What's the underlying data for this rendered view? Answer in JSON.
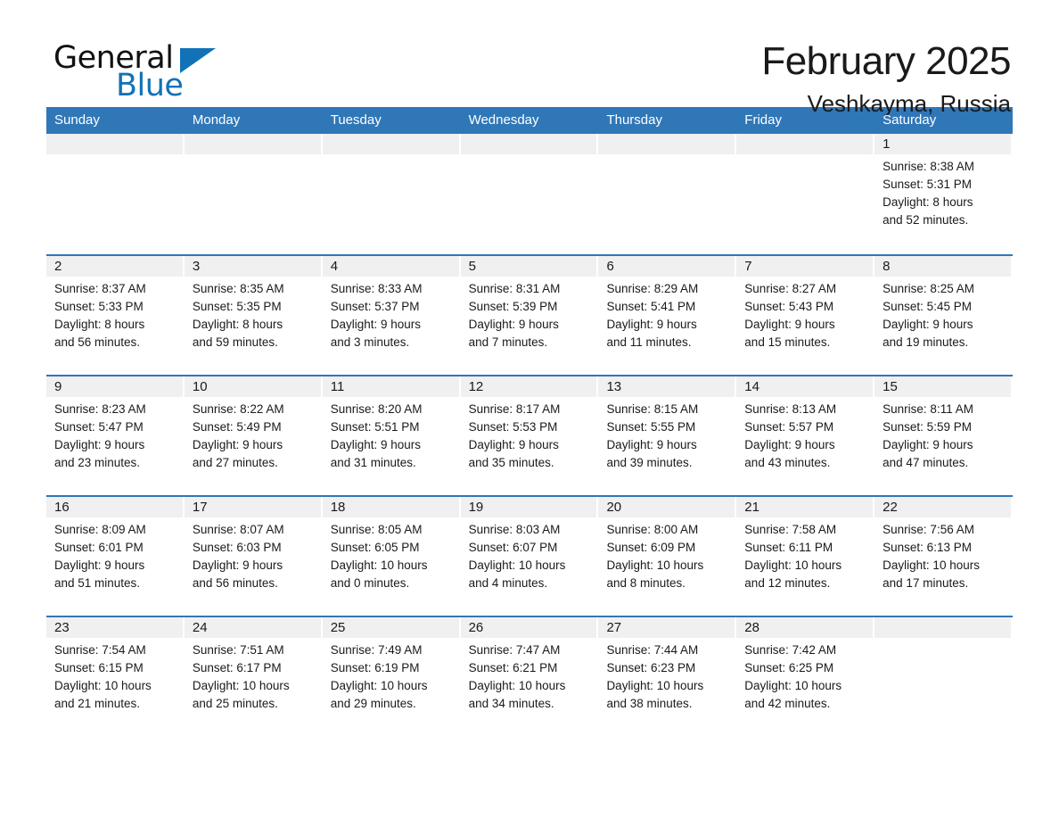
{
  "logo": {
    "text_primary": "General",
    "text_secondary": "Blue",
    "triangle_color": "#1272B8"
  },
  "header": {
    "title": "February 2025",
    "subtitle": "Veshkayma, Russia"
  },
  "theme": {
    "header_blue": "#3077B8",
    "row_rule_blue": "#3077B8",
    "day_band_gray": "#f0f0f0",
    "text_color": "#1a1a1a"
  },
  "weekdays": [
    "Sunday",
    "Monday",
    "Tuesday",
    "Wednesday",
    "Thursday",
    "Friday",
    "Saturday"
  ],
  "labels": {
    "sunrise_prefix": "Sunrise:",
    "sunset_prefix": "Sunset:",
    "daylight_prefix": "Daylight:"
  },
  "weeks": [
    [
      {
        "day": "",
        "line1": "",
        "line2": "",
        "line3": "",
        "line4": ""
      },
      {
        "day": "",
        "line1": "",
        "line2": "",
        "line3": "",
        "line4": ""
      },
      {
        "day": "",
        "line1": "",
        "line2": "",
        "line3": "",
        "line4": ""
      },
      {
        "day": "",
        "line1": "",
        "line2": "",
        "line3": "",
        "line4": ""
      },
      {
        "day": "",
        "line1": "",
        "line2": "",
        "line3": "",
        "line4": ""
      },
      {
        "day": "",
        "line1": "",
        "line2": "",
        "line3": "",
        "line4": ""
      },
      {
        "day": "1",
        "line1": "Sunrise: 8:38 AM",
        "line2": "Sunset: 5:31 PM",
        "line3": "Daylight: 8 hours",
        "line4": "and 52 minutes."
      }
    ],
    [
      {
        "day": "2",
        "line1": "Sunrise: 8:37 AM",
        "line2": "Sunset: 5:33 PM",
        "line3": "Daylight: 8 hours",
        "line4": "and 56 minutes."
      },
      {
        "day": "3",
        "line1": "Sunrise: 8:35 AM",
        "line2": "Sunset: 5:35 PM",
        "line3": "Daylight: 8 hours",
        "line4": "and 59 minutes."
      },
      {
        "day": "4",
        "line1": "Sunrise: 8:33 AM",
        "line2": "Sunset: 5:37 PM",
        "line3": "Daylight: 9 hours",
        "line4": "and 3 minutes."
      },
      {
        "day": "5",
        "line1": "Sunrise: 8:31 AM",
        "line2": "Sunset: 5:39 PM",
        "line3": "Daylight: 9 hours",
        "line4": "and 7 minutes."
      },
      {
        "day": "6",
        "line1": "Sunrise: 8:29 AM",
        "line2": "Sunset: 5:41 PM",
        "line3": "Daylight: 9 hours",
        "line4": "and 11 minutes."
      },
      {
        "day": "7",
        "line1": "Sunrise: 8:27 AM",
        "line2": "Sunset: 5:43 PM",
        "line3": "Daylight: 9 hours",
        "line4": "and 15 minutes."
      },
      {
        "day": "8",
        "line1": "Sunrise: 8:25 AM",
        "line2": "Sunset: 5:45 PM",
        "line3": "Daylight: 9 hours",
        "line4": "and 19 minutes."
      }
    ],
    [
      {
        "day": "9",
        "line1": "Sunrise: 8:23 AM",
        "line2": "Sunset: 5:47 PM",
        "line3": "Daylight: 9 hours",
        "line4": "and 23 minutes."
      },
      {
        "day": "10",
        "line1": "Sunrise: 8:22 AM",
        "line2": "Sunset: 5:49 PM",
        "line3": "Daylight: 9 hours",
        "line4": "and 27 minutes."
      },
      {
        "day": "11",
        "line1": "Sunrise: 8:20 AM",
        "line2": "Sunset: 5:51 PM",
        "line3": "Daylight: 9 hours",
        "line4": "and 31 minutes."
      },
      {
        "day": "12",
        "line1": "Sunrise: 8:17 AM",
        "line2": "Sunset: 5:53 PM",
        "line3": "Daylight: 9 hours",
        "line4": "and 35 minutes."
      },
      {
        "day": "13",
        "line1": "Sunrise: 8:15 AM",
        "line2": "Sunset: 5:55 PM",
        "line3": "Daylight: 9 hours",
        "line4": "and 39 minutes."
      },
      {
        "day": "14",
        "line1": "Sunrise: 8:13 AM",
        "line2": "Sunset: 5:57 PM",
        "line3": "Daylight: 9 hours",
        "line4": "and 43 minutes."
      },
      {
        "day": "15",
        "line1": "Sunrise: 8:11 AM",
        "line2": "Sunset: 5:59 PM",
        "line3": "Daylight: 9 hours",
        "line4": "and 47 minutes."
      }
    ],
    [
      {
        "day": "16",
        "line1": "Sunrise: 8:09 AM",
        "line2": "Sunset: 6:01 PM",
        "line3": "Daylight: 9 hours",
        "line4": "and 51 minutes."
      },
      {
        "day": "17",
        "line1": "Sunrise: 8:07 AM",
        "line2": "Sunset: 6:03 PM",
        "line3": "Daylight: 9 hours",
        "line4": "and 56 minutes."
      },
      {
        "day": "18",
        "line1": "Sunrise: 8:05 AM",
        "line2": "Sunset: 6:05 PM",
        "line3": "Daylight: 10 hours",
        "line4": "and 0 minutes."
      },
      {
        "day": "19",
        "line1": "Sunrise: 8:03 AM",
        "line2": "Sunset: 6:07 PM",
        "line3": "Daylight: 10 hours",
        "line4": "and 4 minutes."
      },
      {
        "day": "20",
        "line1": "Sunrise: 8:00 AM",
        "line2": "Sunset: 6:09 PM",
        "line3": "Daylight: 10 hours",
        "line4": "and 8 minutes."
      },
      {
        "day": "21",
        "line1": "Sunrise: 7:58 AM",
        "line2": "Sunset: 6:11 PM",
        "line3": "Daylight: 10 hours",
        "line4": "and 12 minutes."
      },
      {
        "day": "22",
        "line1": "Sunrise: 7:56 AM",
        "line2": "Sunset: 6:13 PM",
        "line3": "Daylight: 10 hours",
        "line4": "and 17 minutes."
      }
    ],
    [
      {
        "day": "23",
        "line1": "Sunrise: 7:54 AM",
        "line2": "Sunset: 6:15 PM",
        "line3": "Daylight: 10 hours",
        "line4": "and 21 minutes."
      },
      {
        "day": "24",
        "line1": "Sunrise: 7:51 AM",
        "line2": "Sunset: 6:17 PM",
        "line3": "Daylight: 10 hours",
        "line4": "and 25 minutes."
      },
      {
        "day": "25",
        "line1": "Sunrise: 7:49 AM",
        "line2": "Sunset: 6:19 PM",
        "line3": "Daylight: 10 hours",
        "line4": "and 29 minutes."
      },
      {
        "day": "26",
        "line1": "Sunrise: 7:47 AM",
        "line2": "Sunset: 6:21 PM",
        "line3": "Daylight: 10 hours",
        "line4": "and 34 minutes."
      },
      {
        "day": "27",
        "line1": "Sunrise: 7:44 AM",
        "line2": "Sunset: 6:23 PM",
        "line3": "Daylight: 10 hours",
        "line4": "and 38 minutes."
      },
      {
        "day": "28",
        "line1": "Sunrise: 7:42 AM",
        "line2": "Sunset: 6:25 PM",
        "line3": "Daylight: 10 hours",
        "line4": "and 42 minutes."
      },
      {
        "day": "",
        "line1": "",
        "line2": "",
        "line3": "",
        "line4": ""
      }
    ]
  ]
}
